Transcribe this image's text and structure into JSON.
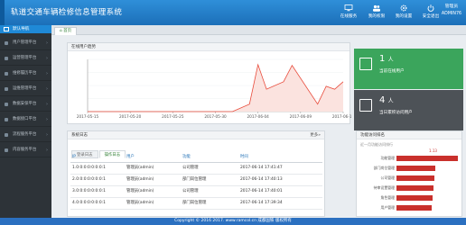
{
  "header": {
    "title": "轨道交通车辆检修信息管理系统",
    "items": [
      {
        "label": "在线服务",
        "icon": "monitor-icon"
      },
      {
        "label": "我的权限",
        "icon": "user-group-icon"
      },
      {
        "label": "我的设置",
        "icon": "gear-icon"
      },
      {
        "label": "安全退出",
        "icon": "power-icon"
      }
    ],
    "user_name": "管理员",
    "user_id": "ADMIN76"
  },
  "sidebar": {
    "active": "默认导航",
    "items": [
      "用户管理平台",
      "运营管理平台",
      "维修履历平台",
      "运维管理平台",
      "数据安保平台",
      "数据接口平台",
      "流程服务平台",
      "内容服务平台"
    ]
  },
  "tabs": {
    "home": "首页"
  },
  "chart_panel": {
    "title": "在线用户趋势"
  },
  "chart_data": {
    "type": "line",
    "x": [
      "2017-05-15",
      "2017-05-20",
      "2017-05-25",
      "2017-05-30",
      "2017-06-04",
      "2017-06-09",
      "2017-06-14"
    ],
    "ylim": [
      0,
      7
    ],
    "points": [
      [
        "2017-05-15",
        0
      ],
      [
        "2017-06-01",
        0
      ],
      [
        "2017-06-03",
        1
      ],
      [
        "2017-06-04",
        6.3
      ],
      [
        "2017-06-05",
        3
      ],
      [
        "2017-06-07",
        4
      ],
      [
        "2017-06-08",
        6.2
      ],
      [
        "2017-06-11",
        1
      ],
      [
        "2017-06-12",
        3.4
      ],
      [
        "2017-06-13",
        3
      ],
      [
        "2017-06-14",
        4
      ]
    ],
    "colors": {
      "line": "#e84a3a",
      "area": "#fbe3df"
    }
  },
  "stats": [
    {
      "value": "1",
      "unit": "人",
      "label": "当前在线用户",
      "color": "#3ba55c"
    },
    {
      "value": "4",
      "unit": "人",
      "label": "当日累积访问用户",
      "color": "#4d5257"
    }
  ],
  "log_panel": {
    "title": "系统日志",
    "more": "更多»",
    "subtabs": [
      "登录日志",
      "操作日志"
    ],
    "columns": [
      "IP",
      "用户",
      "功能",
      "时间"
    ],
    "rows": [
      {
        "ip": "1.0:0:0:0:0:0:0:1",
        "user": "管理员(admin)",
        "func": "公司管理",
        "time": "2017-06-14 17:41:47"
      },
      {
        "ip": "2.0:0:0:0:0:0:0:1",
        "user": "管理员(admin)",
        "func": "部门岗位管理",
        "time": "2017-06-14 17:40:13"
      },
      {
        "ip": "3.0:0:0:0:0:0:0:1",
        "user": "管理员(admin)",
        "func": "公司管理",
        "time": "2017-06-14 17:40:01"
      },
      {
        "ip": "4.0:0:0:0:0:0:0:1",
        "user": "管理员(admin)",
        "func": "部门岗位管理",
        "time": "2017-06-14 17:39:34"
      }
    ]
  },
  "hot_panel": {
    "title": "功能访问排名",
    "subtitle": "近一月功能访问排行",
    "value_label": "1.13",
    "bars": [
      {
        "label": "功能管理",
        "value": 1.13
      },
      {
        "label": "部门岗位管理",
        "value": 0.72
      },
      {
        "label": "公司管理",
        "value": 0.7
      },
      {
        "label": "待审设置管理",
        "value": 0.68
      },
      {
        "label": "角色管理",
        "value": 0.66
      },
      {
        "label": "用户管理",
        "value": 0.64
      }
    ]
  },
  "footer": {
    "text": "Copyright © 2016 2017. www.ramcol.cn 成都国铁 版权所有"
  }
}
